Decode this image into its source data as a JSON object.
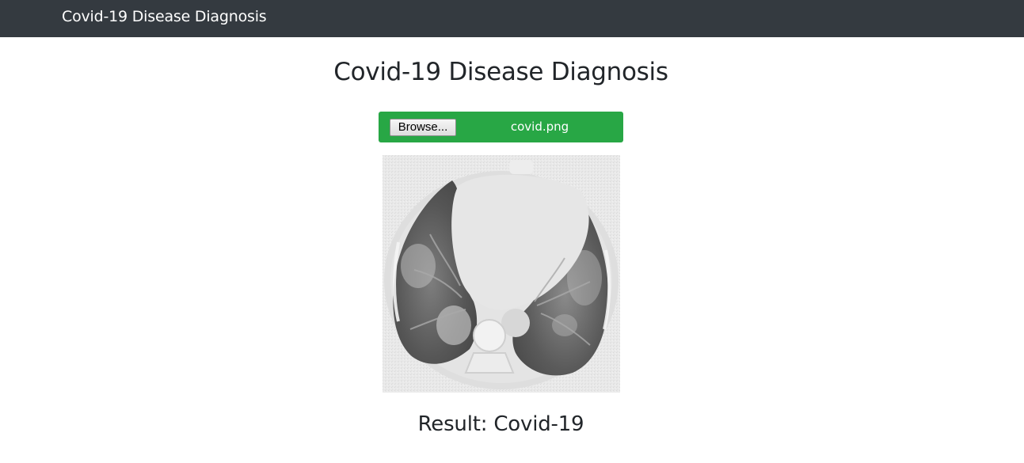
{
  "navbar": {
    "brand": "Covid-19 Disease Diagnosis"
  },
  "main": {
    "title": "Covid-19 Disease Diagnosis",
    "upload": {
      "browse_label": "Browse...",
      "file_name": "covid.png",
      "bar_color": "#28a745"
    },
    "image": {
      "description_icon": "chest-ct-scan-image"
    },
    "result": {
      "text": "Result: Covid-19"
    }
  },
  "colors": {
    "navbar": "#343a40",
    "text": "#212529",
    "upload_bar": "#28a745"
  }
}
